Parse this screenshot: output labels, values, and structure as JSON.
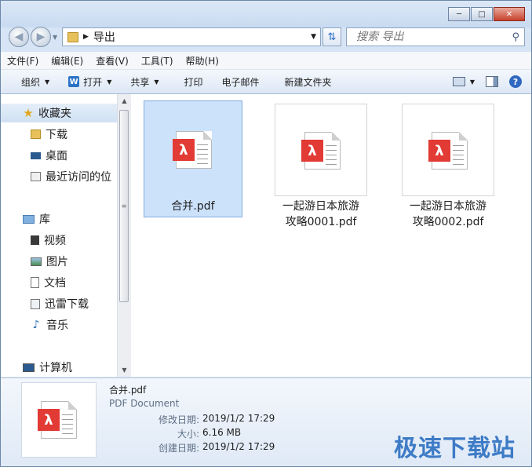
{
  "nav": {
    "path": "导出",
    "search_placeholder": "搜索 导出"
  },
  "menu": [
    "文件(F)",
    "编辑(E)",
    "查看(V)",
    "工具(T)",
    "帮助(H)"
  ],
  "toolbar": {
    "organize": "组织",
    "open": "打开",
    "share": "共享",
    "print": "打印",
    "email": "电子邮件",
    "new_folder": "新建文件夹"
  },
  "sidebar": {
    "favorites": "收藏夹",
    "downloads": "下载",
    "desktop": "桌面",
    "recent": "最近访问的位",
    "libraries": "库",
    "videos": "视频",
    "pictures": "图片",
    "documents": "文档",
    "xunlei": "迅雷下载",
    "music": "音乐",
    "computer": "计算机"
  },
  "files": [
    {
      "name_line1": "合并.pdf",
      "name_line2": "",
      "selected": true
    },
    {
      "name_line1": "一起游日本旅游",
      "name_line2": "攻略0001.pdf",
      "selected": false
    },
    {
      "name_line1": "一起游日本旅游",
      "name_line2": "攻略0002.pdf",
      "selected": false
    }
  ],
  "details": {
    "name": "合并.pdf",
    "type": "PDF Document",
    "modified_label": "修改日期:",
    "modified": "2019/1/2 17:29",
    "size_label": "大小:",
    "size": "6.16 MB",
    "created_label": "创建日期:",
    "created": "2019/1/2 17:29"
  },
  "watermark": "极速下载站",
  "colors": {
    "pdf_red": "#e23a34",
    "selection": "#cce2fb",
    "accent": "#3d7bc6"
  }
}
